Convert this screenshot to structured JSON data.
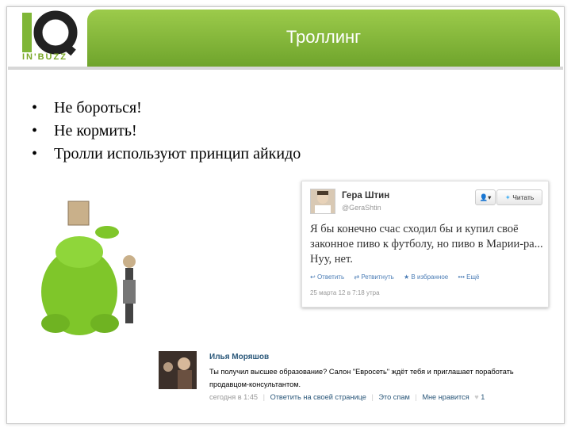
{
  "logo": {
    "letters": "IQ",
    "sub": "IN'BUZZ"
  },
  "slide": {
    "title": "Троллинг"
  },
  "bullets": [
    "Не бороться!",
    "Не кормить!",
    "Тролли используют принцип айкидо"
  ],
  "bullet_glyph": "•",
  "tweet": {
    "name": "Гера Штин",
    "handle": "@GeraShtin",
    "follow_icon": "👤▾",
    "follow_label": "Читать",
    "text": "Я бы конечно счас сходил бы и купил своё законное пиво к футболу, но пиво в Марии-ра... Нуу, нет.",
    "actions": [
      "Ответить",
      "Ретвитнуть",
      "В избранное",
      "Ещё"
    ],
    "date": "25 марта 12 в 7:18 утра"
  },
  "vk": {
    "name": "Илья Моряшов",
    "text": "Ты получил высшее образование? Салон \"Евросеть\" ждёт тебя и приглашает поработать продавцом-консультантом.",
    "time": "сегодня в 1:45",
    "reply": "Ответить на своей странице",
    "spam": "Это спам",
    "like": "Мне нравится",
    "like_count": "1"
  },
  "colors": {
    "accent_green": "#7fb637",
    "link_blue": "#2b587a",
    "twitter_blue": "#4a7cb5"
  }
}
